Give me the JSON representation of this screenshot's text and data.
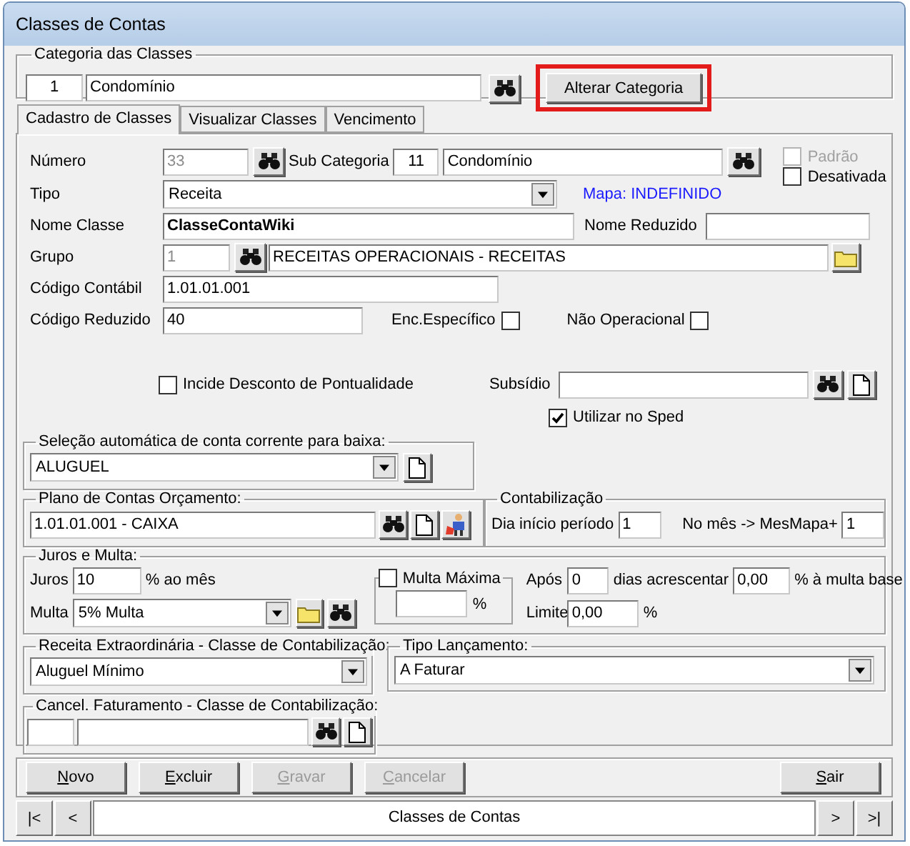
{
  "window": {
    "title": "Classes de Contas"
  },
  "category": {
    "legend": "Categoria das Classes",
    "code": "1",
    "name": "Condomínio",
    "action": {
      "label": "Alterar Categoria",
      "highlighted": true
    }
  },
  "tabs": [
    {
      "label": "Cadastro de Classes",
      "selected": true
    },
    {
      "label": "Visualizar Classes",
      "selected": false
    },
    {
      "label": "Vencimento",
      "selected": false
    }
  ],
  "main": {
    "numero": {
      "label": "Número",
      "value": "33",
      "disabled": true
    },
    "sub_categoria": {
      "label": "Sub Categoria",
      "code": "11",
      "name": "Condomínio"
    },
    "flags": [
      {
        "label": "Padrão",
        "checked": false,
        "disabled": true
      },
      {
        "label": "Desativada",
        "checked": false,
        "disabled": false
      }
    ],
    "tipo": {
      "label": "Tipo",
      "value": "Receita"
    },
    "mapa": "Mapa: INDEFINIDO",
    "nome_classe": {
      "label": "Nome Classe",
      "value": "ClasseContaWiki"
    },
    "nome_reduzido": {
      "label": "Nome Reduzido"
    },
    "grupo": {
      "label": "Grupo",
      "code": "1",
      "code_disabled": true,
      "name": "RECEITAS OPERACIONAIS - RECEITAS"
    },
    "codigo_contabil": {
      "label": "Código Contábil",
      "value": "1.01.01.001"
    },
    "codigo_reduzido": {
      "label": "Código Reduzido",
      "value": "40"
    },
    "enc_especifico": {
      "label": "Enc.Específico",
      "checked": false
    },
    "nao_operacional": {
      "label": "Não Operacional",
      "checked": false
    },
    "incide_desconto": {
      "label": "Incide Desconto de Pontualidade",
      "checked": false
    },
    "subsidio": {
      "label": "Subsídio"
    },
    "utilizar_sped": {
      "label": "Utilizar no Sped",
      "checked": true
    }
  },
  "selecao": {
    "legend": "Seleção automática de conta corrente para baixa:",
    "value": "ALUGUEL"
  },
  "plano": {
    "legend": "Plano de Contas Orçamento:",
    "value": "1.01.01.001 - CAIXA"
  },
  "contabilizacao": {
    "legend": "Contabilização",
    "dia_label": "Dia início período",
    "dia": "1",
    "mes_label": "No mês -> MesMapa+",
    "mes": "1"
  },
  "juros_multa": {
    "legend": "Juros e Multa:",
    "juros_label": "Juros",
    "juros": "10",
    "juros_unit": "% ao mês",
    "multa_label": "Multa",
    "multa": "5% Multa",
    "multa_maxima": {
      "label": "Multa Máxima",
      "checked": false,
      "unit": "%"
    },
    "apos_label": "Após",
    "apos": "0",
    "dias_label": "dias acrescentar",
    "acrescentar": "0,00",
    "acrescentar_unit": "% à multa base",
    "limite_label": "Limite",
    "limite": "0,00",
    "limite_unit": "%"
  },
  "receita_extra": {
    "legend": "Receita Extraordinária - Classe de Contabilização:",
    "value": "Aluguel Mínimo"
  },
  "tipo_lancamento": {
    "legend": "Tipo Lançamento:",
    "value": "A Faturar"
  },
  "cancel_faturamento": {
    "legend": "Cancel. Faturamento - Classe de Contabilização:"
  },
  "buttons": [
    {
      "label": "Novo",
      "disabled": false
    },
    {
      "label": "Excluir",
      "disabled": false
    },
    {
      "label": "Gravar",
      "disabled": true
    },
    {
      "label": "Cancelar",
      "disabled": true
    },
    {
      "label": "Sair",
      "disabled": false
    }
  ],
  "navigator": {
    "first": "|<",
    "prev": "<",
    "caption": "Classes de Contas",
    "next": ">",
    "last": ">|"
  }
}
